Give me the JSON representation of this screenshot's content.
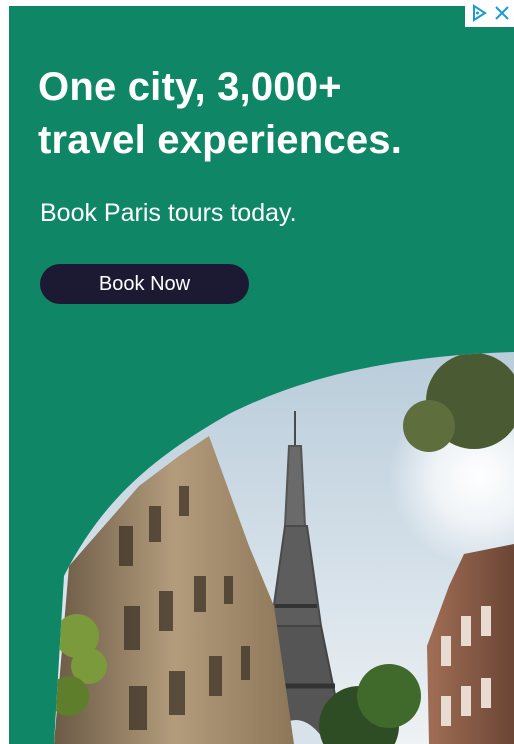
{
  "ad": {
    "headline_line1": "One city, 3,000+",
    "headline_line2": "travel experiences.",
    "subheadline": "Book Paris tours today.",
    "cta_label": "Book Now",
    "image_label": "Eiffel Tower and Parisian buildings",
    "colors": {
      "background": "#0f8766",
      "cta_background": "#1c1a33",
      "text": "#ffffff",
      "adchoices": "#1a9ad6"
    }
  },
  "controls": {
    "adchoices_icon": "adchoices-icon",
    "close_icon": "close-icon"
  }
}
